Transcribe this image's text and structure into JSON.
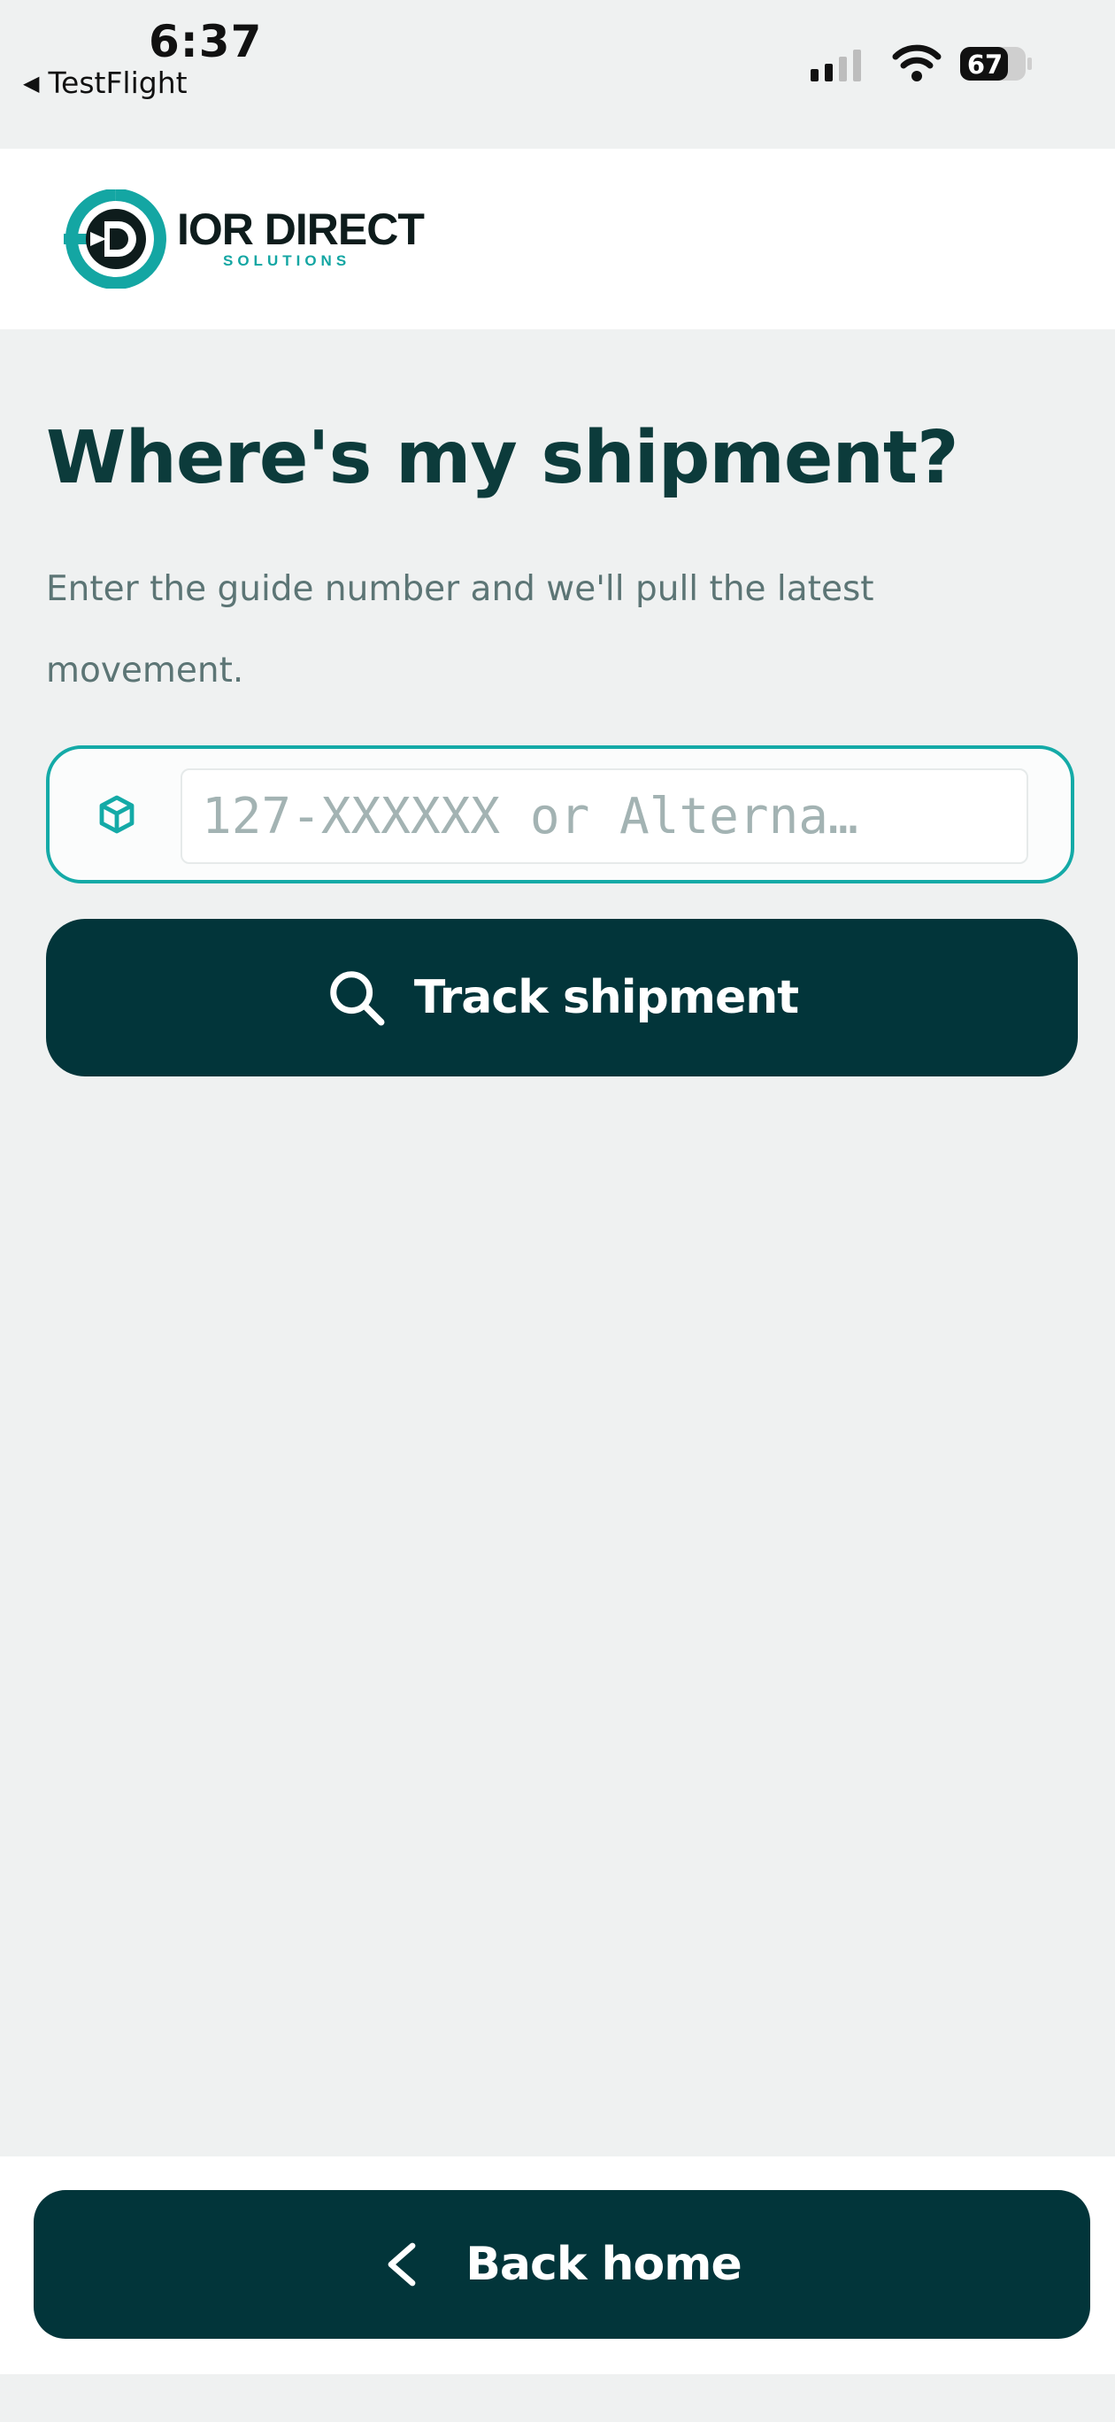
{
  "status_bar": {
    "time": "6:37",
    "back_app_label": "TestFlight",
    "battery_level": "67",
    "signal_bars_active": 2,
    "signal_bars_total": 4
  },
  "header": {
    "brand_name": "IOR DIRECT",
    "brand_tagline": "SOLUTIONS"
  },
  "main": {
    "title": "Where's my shipment?",
    "subtitle": "Enter the guide number and we'll pull the latest movement.",
    "search": {
      "placeholder": "127-XXXXXX or Alterna…",
      "value": "",
      "icon": "package-icon"
    },
    "track_button": {
      "label": "Track shipment",
      "icon": "search-icon"
    }
  },
  "footer": {
    "back_button": {
      "label": "Back home",
      "icon": "chevron-left-icon"
    }
  },
  "colors": {
    "primary_dark": "#02353a",
    "accent_teal": "#14aaa7",
    "title_color": "#0c3b3b",
    "subtitle_color": "#5c7575",
    "background": "#eff1f1"
  }
}
